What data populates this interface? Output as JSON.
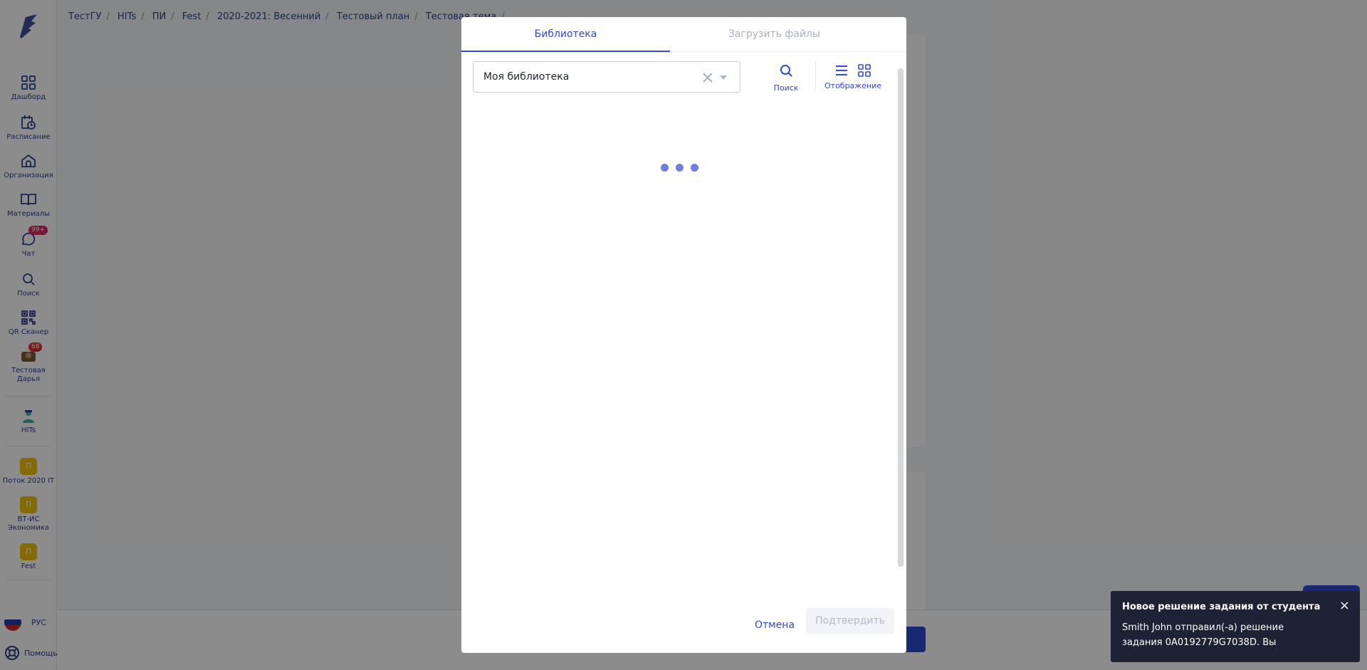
{
  "sidebar": {
    "items": [
      {
        "label": "Дашборд",
        "icon": "dashboard-icon"
      },
      {
        "label": "Расписание",
        "icon": "calendar-icon"
      },
      {
        "label": "Организация",
        "icon": "home-icon"
      },
      {
        "label": "Материалы",
        "icon": "book-icon"
      },
      {
        "label": "Чат",
        "icon": "chat-icon",
        "badge": "99+"
      },
      {
        "label": "Поиск",
        "icon": "search-icon"
      },
      {
        "label": "QR Сканер",
        "icon": "qr-icon"
      },
      {
        "label": "Тестовая Дарья",
        "icon": "avatar-icon",
        "badge": "68"
      },
      {
        "label": "HITs",
        "icon": "hits-icon"
      },
      {
        "label": "Поток 2020 IT",
        "letter": "П"
      },
      {
        "label": "ВТ-ИС Экономика",
        "letter": "П"
      },
      {
        "label": "Fest",
        "letter": "П"
      }
    ],
    "lang": "РУС",
    "help": "Помощь"
  },
  "breadcrumb": [
    "ТестГУ",
    "HITs",
    "ПИ",
    "Fest",
    "2020-2021: Весенний",
    "Тестовый план",
    "Тестовая тема"
  ],
  "modal": {
    "tabs": {
      "library": "Библиотека",
      "upload": "Загрузить файлы"
    },
    "select_value": "Моя библиотека",
    "search_label": "Поиск",
    "view_label": "Отображение",
    "cancel": "Отмена",
    "confirm": "Подтвердить"
  },
  "toast": {
    "title": "Новое решение задания от студента",
    "body": "Smith John отправил(-а) решение задания 0A0192779G7038D. Вы"
  },
  "colors": {
    "accent": "#2f49d1",
    "badge": "#e0245e",
    "group": "#f2c200"
  }
}
